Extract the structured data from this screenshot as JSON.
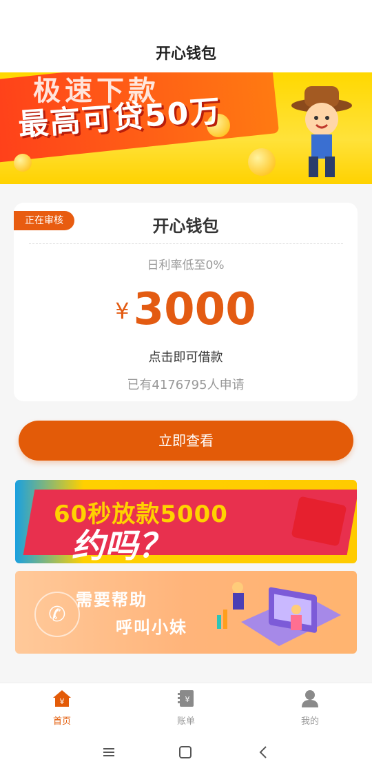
{
  "header": {
    "title": "开心钱包"
  },
  "hero": {
    "line1": "极速下款",
    "line2": "最高可贷50万"
  },
  "card": {
    "status_tag": "正在审核",
    "title": "开心钱包",
    "rate_text": "日利率低至0%",
    "currency_symbol": "¥",
    "amount": "3000",
    "hint": "点击即可借款",
    "applicant_count": "已有4176795人申请"
  },
  "cta": {
    "label": "立即查看"
  },
  "promo1": {
    "text1": "60秒放款5000",
    "text2": "约吗？"
  },
  "promo2": {
    "text1": "需要帮助",
    "text2": "呼叫小妹"
  },
  "tabs": [
    {
      "label": "首页",
      "icon": "home-icon",
      "active": true
    },
    {
      "label": "账单",
      "icon": "bill-icon",
      "active": false
    },
    {
      "label": "我的",
      "icon": "profile-icon",
      "active": false
    }
  ],
  "colors": {
    "accent": "#e35b08",
    "tag": "#e85c10",
    "amount": "#e35b12"
  }
}
